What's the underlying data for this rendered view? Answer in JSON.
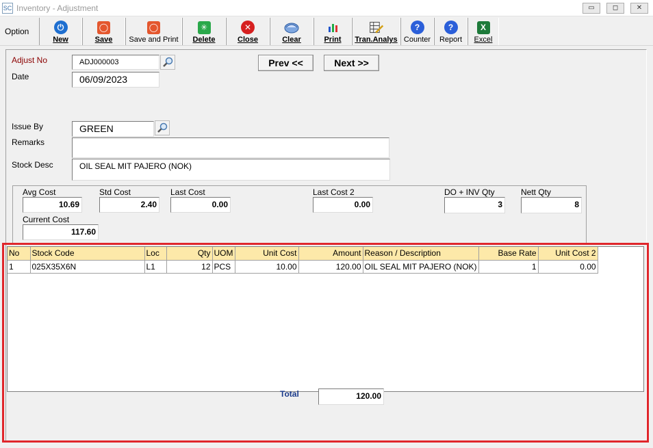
{
  "window": {
    "title": "Inventory - Adjustment",
    "app_icon": "SC",
    "controls": {
      "minimize": "▭",
      "maximize": "◻",
      "close": "✕"
    }
  },
  "toolbar": {
    "option_label": "Option",
    "buttons": [
      {
        "label": "New",
        "icon": "power-icon"
      },
      {
        "label": "Save",
        "icon": "save-icon"
      },
      {
        "label": "Save and Print",
        "icon": "save-print-icon"
      },
      {
        "label": "Delete",
        "icon": "delete-icon"
      },
      {
        "label": "Close",
        "icon": "close-icon"
      },
      {
        "label": "Clear",
        "icon": "clear-icon"
      },
      {
        "label": "Print",
        "icon": "print-icon"
      },
      {
        "label": "Tran.Analys",
        "icon": "tran-analys-icon"
      },
      {
        "label": "Counter",
        "icon": "help-icon"
      },
      {
        "label": "Report",
        "icon": "help-icon"
      },
      {
        "label": "Excel",
        "icon": "excel-icon"
      }
    ]
  },
  "header": {
    "adjust_no_label": "Adjust  No",
    "adjust_no": "ADJ000003",
    "date_label": "Date",
    "date": "06/09/2023",
    "prev_label": "Prev <<",
    "next_label": "Next >>",
    "issue_by_label": "Issue By",
    "issue_by": "GREEN",
    "remarks_label": "Remarks",
    "remarks": "",
    "stock_desc_label": "Stock Desc",
    "stock_desc": "OIL SEAL MIT PAJERO (NOK)"
  },
  "costs": {
    "avg_cost_label": "Avg Cost",
    "avg_cost": "10.69",
    "std_cost_label": "Std Cost",
    "std_cost": "2.40",
    "last_cost_label": "Last Cost",
    "last_cost": "0.00",
    "last_cost2_label": "Last Cost 2",
    "last_cost2": "0.00",
    "do_inv_qty_label": "DO + INV Qty",
    "do_inv_qty": "3",
    "nett_qty_label": "Nett Qty",
    "nett_qty": "8",
    "current_cost_label": "Current Cost",
    "current_cost": "117.60"
  },
  "grid": {
    "columns": [
      "No",
      "Stock Code",
      "Loc",
      "Qty",
      "UOM",
      "Unit Cost",
      "Amount",
      "Reason / Description",
      "Base Rate",
      "Unit Cost 2"
    ],
    "rows": [
      [
        "1",
        "025X35X6N",
        "L1",
        "12",
        "PCS",
        "10.00",
        "120.00",
        "OIL SEAL MIT PAJERO (NOK)",
        "1",
        "0.00"
      ]
    ]
  },
  "total": {
    "label": "Total",
    "value": "120.00"
  },
  "colors": {
    "header_bg": "#fde9a9",
    "highlight": "#e0262b",
    "label_red": "#8b0000"
  }
}
